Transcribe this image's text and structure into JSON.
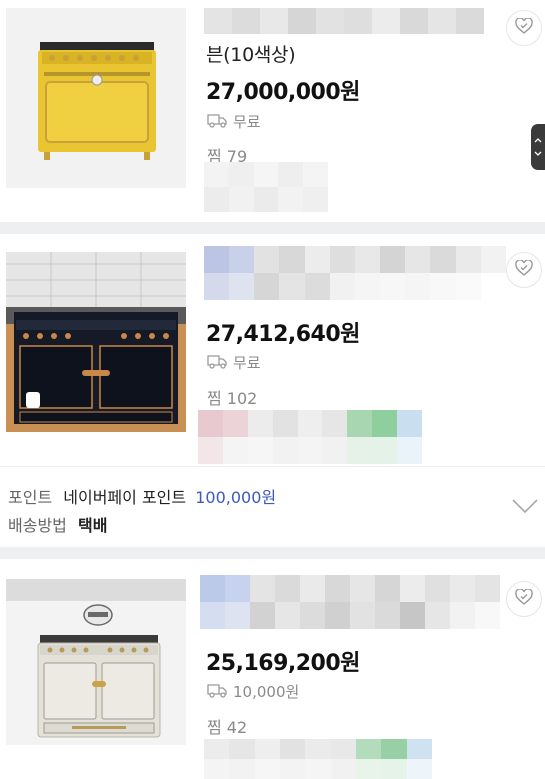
{
  "products": [
    {
      "title_partial": "븐(10색상)",
      "price": "27,000,000원",
      "shipping": "무료",
      "zzim": "찜 79"
    },
    {
      "price": "27,412,640원",
      "shipping": "무료",
      "zzim": "찜 102",
      "point_label": "포인트",
      "point_source": "네이버페이 포인트",
      "point_amount": "100,000원",
      "delivery_label": "배송방법",
      "delivery_value": "택배"
    },
    {
      "price": "25,169,200원",
      "shipping": "10,000원",
      "zzim": "찜 42"
    }
  ],
  "icons": {
    "wishlist": "heart-check-icon",
    "shipping": "truck-icon",
    "expand": "chevron-down-icon"
  },
  "colors": {
    "price": "#111111",
    "point_amount": "#3b5bbd",
    "divider": "#eeeff1"
  }
}
